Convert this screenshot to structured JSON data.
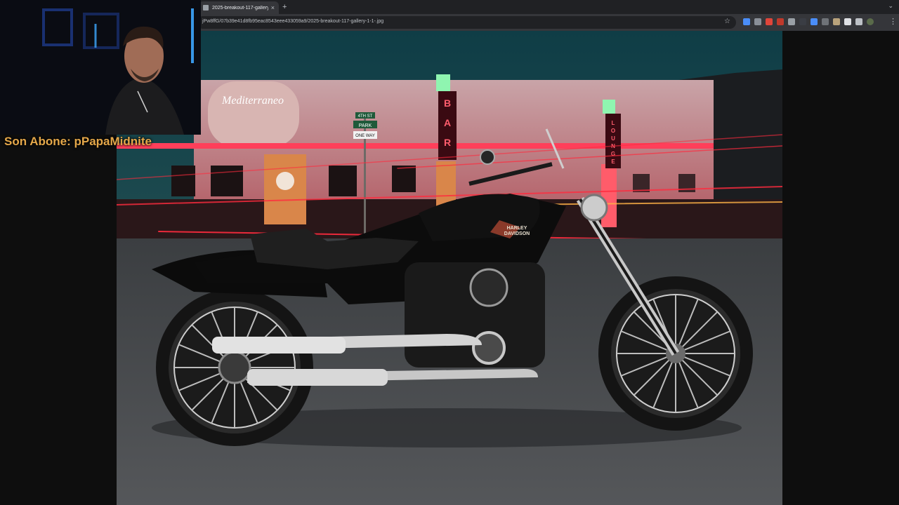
{
  "browser": {
    "tab": {
      "title": "2025-breakout-117-gallery-1-"
    },
    "new_tab_symbol": "+",
    "close_symbol": "×",
    "url": "jPw8ffG/07b39e41d8fb95eac8543eee433059a9/2025-breakout-117-gallery-1-1-.jpg",
    "star_symbol": "☆",
    "menu_symbol": "⋮",
    "tab_search_symbol": "⌄",
    "extensions": [
      {
        "icon": "ext-blue-icon",
        "color": "#4a8df8"
      },
      {
        "icon": "ext-grey-icon",
        "color": "#8a8f98"
      },
      {
        "icon": "ext-red-icon",
        "color": "#e0453a"
      },
      {
        "icon": "ext-red2-icon",
        "color": "#c0392b"
      },
      {
        "icon": "ext-lock-icon",
        "color": "#9aa0a6"
      },
      {
        "icon": "ext-dark-icon",
        "color": "#3a3d44"
      },
      {
        "icon": "ext-translate-icon",
        "color": "#4a8df8"
      },
      {
        "icon": "ext-grey2-icon",
        "color": "#6f7378"
      },
      {
        "icon": "ext-cookie-icon",
        "color": "#b9a37c"
      },
      {
        "icon": "ext-shield-icon",
        "color": "#dfe1e5"
      },
      {
        "icon": "ext-puzzle-icon",
        "color": "#bdc1c6"
      },
      {
        "icon": "profile-avatar-icon",
        "color": "#5a6b4a"
      }
    ]
  },
  "overlay": {
    "streamer_text": "Son Abone: pPapaMidnite"
  },
  "photo": {
    "signs": {
      "bar": "BAR",
      "lounge": "LOUNGE",
      "street_1": "4TH ST",
      "street_2": "PARK",
      "street_3": "ONE WAY",
      "diner_script": "Mediterraneo"
    },
    "tank_logo": {
      "line1": "HARLEY",
      "line2": "DAVIDSON"
    }
  }
}
